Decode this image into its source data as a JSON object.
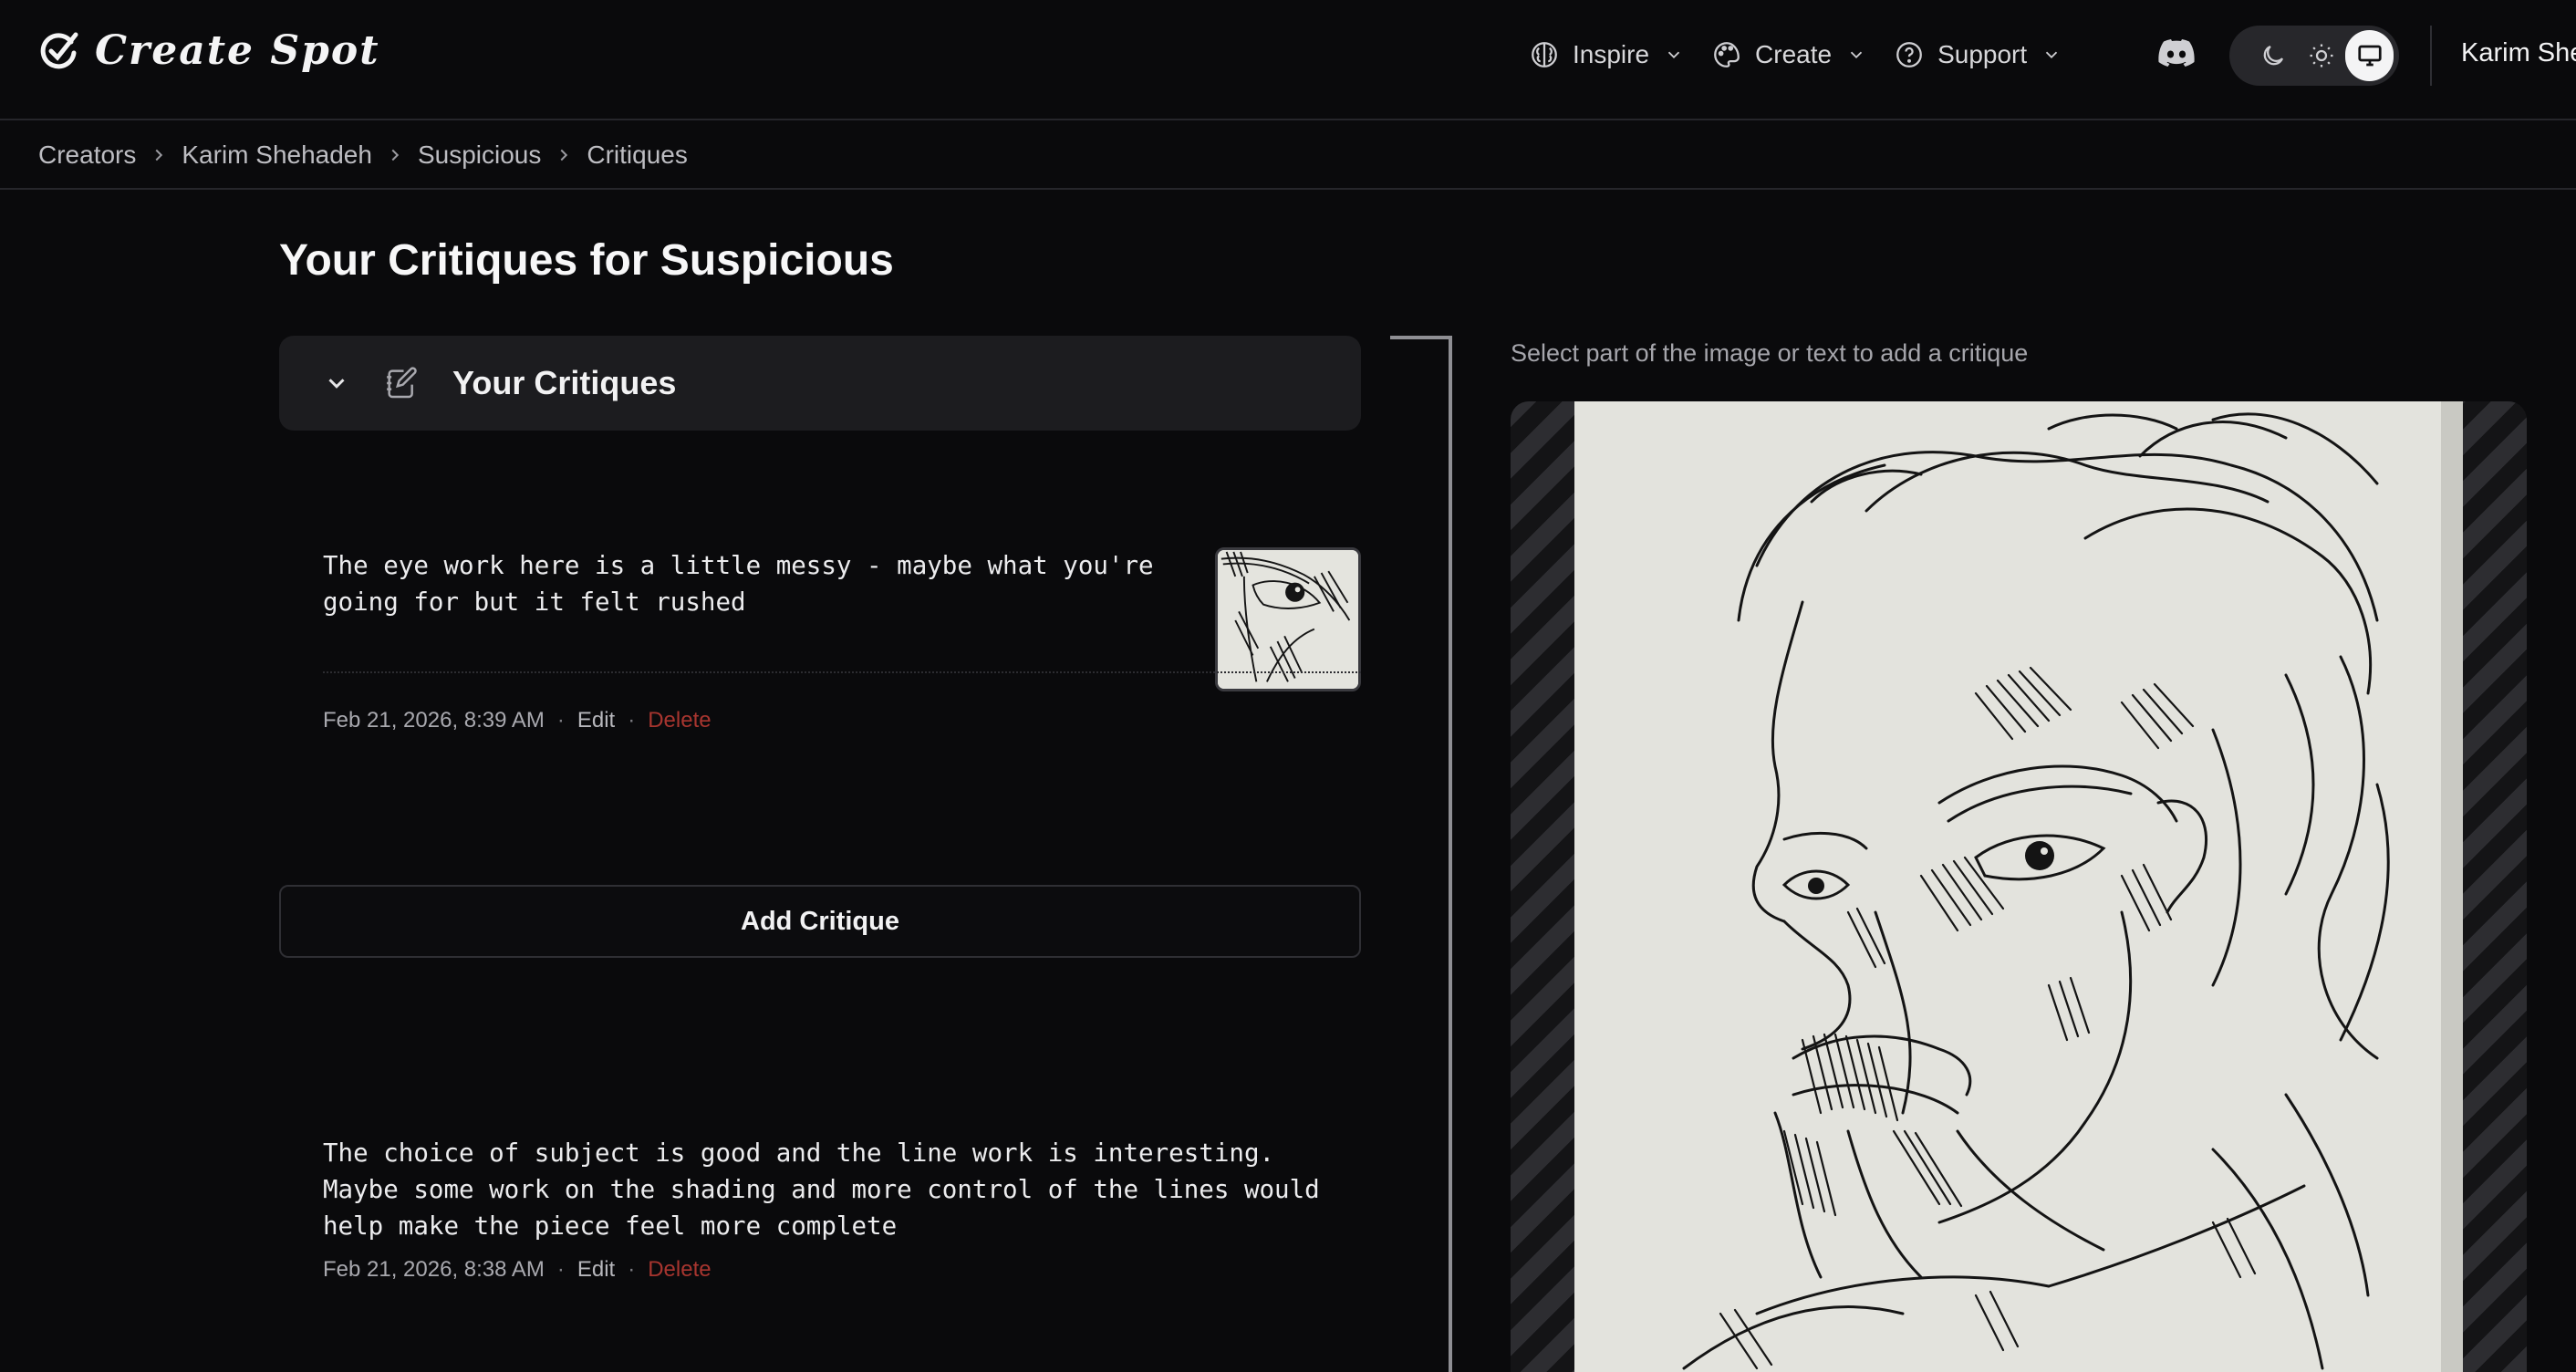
{
  "brand": {
    "name": "Create Spot",
    "logo_icon": "check-circle-icon"
  },
  "nav": {
    "items": [
      {
        "label": "Inspire",
        "icon": "brain-icon"
      },
      {
        "label": "Create",
        "icon": "palette-icon"
      },
      {
        "label": "Support",
        "icon": "help-circle-icon"
      }
    ],
    "discord_icon": "discord-icon",
    "theme": {
      "options": [
        "dark",
        "light",
        "system"
      ],
      "selected": "system"
    },
    "user": "Karim She"
  },
  "breadcrumb": [
    "Creators",
    "Karim Shehadeh",
    "Suspicious",
    "Critiques"
  ],
  "page": {
    "title": "Your Critiques for Suspicious"
  },
  "critiques_panel": {
    "title": "Your Critiques",
    "items": [
      {
        "text": "The eye work here is a little messy - maybe what you're going for but it felt rushed",
        "date": "Feb 21, 2026, 8:39 AM",
        "edit": "Edit",
        "delete": "Delete",
        "has_thumbnail": true
      },
      {
        "text": "The choice of subject is good and the line work is interesting. Maybe some work on the shading and more control of the lines would help make the piece feel more complete",
        "date": "Feb 21, 2026, 8:38 AM",
        "edit": "Edit",
        "delete": "Delete",
        "has_thumbnail": false
      }
    ],
    "add_button": "Add Critique"
  },
  "viewer": {
    "hint": "Select part of the image or text to add a critique"
  },
  "colors": {
    "background": "#0a0a0c",
    "panel": "#1c1c1f",
    "delete": "#a8352f",
    "artwork_paper": "#e3e3dd"
  }
}
